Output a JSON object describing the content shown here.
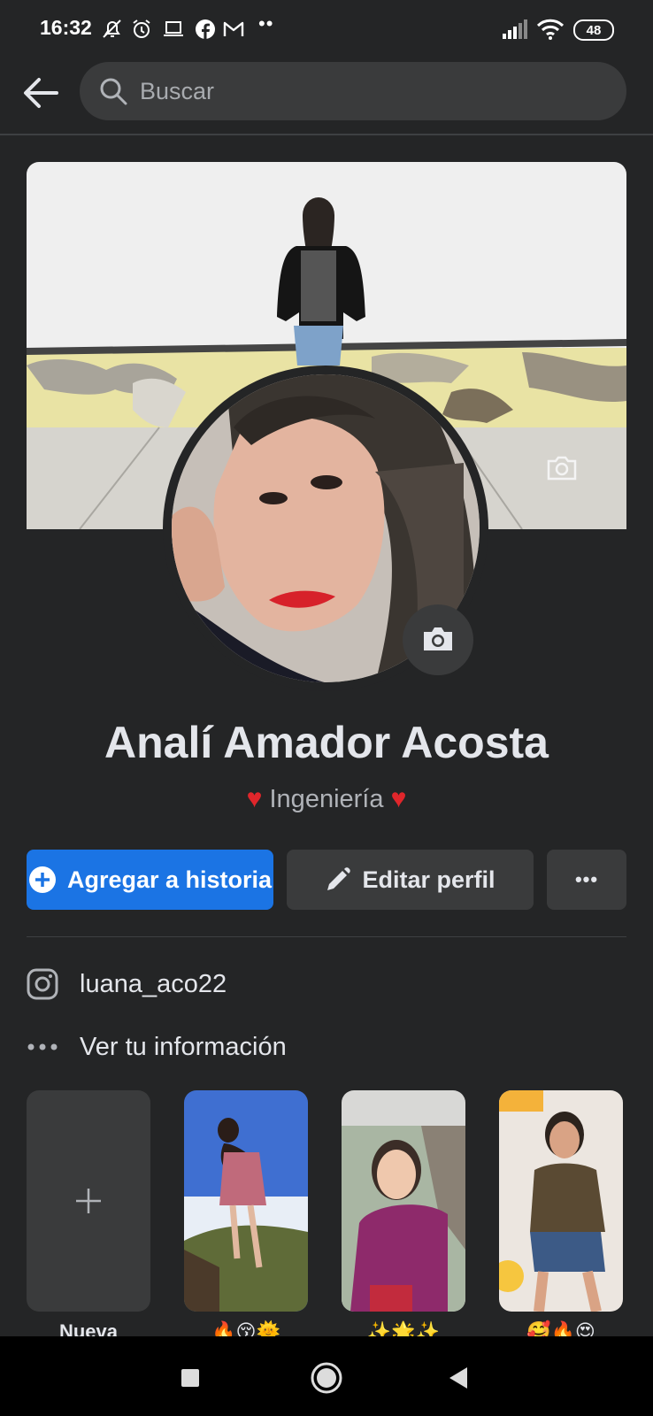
{
  "status_bar": {
    "time": "16:32",
    "icons": [
      "mute-icon",
      "alarm-icon",
      "laptop-icon",
      "facebook-icon",
      "gmail-icon"
    ],
    "more": "••",
    "battery": "48"
  },
  "header": {
    "search_placeholder": "Buscar"
  },
  "profile": {
    "name": "Analí Amador Acosta",
    "bio_heart_left": "♥",
    "bio_text": "Ingeniería",
    "bio_heart_right": "♥"
  },
  "actions": {
    "story_label": "Agregar a historia",
    "edit_label": "Editar perfil",
    "more_label": "•••"
  },
  "info": {
    "instagram": "luana_aco22",
    "see_info": "Ver tu información"
  },
  "highlights": [
    {
      "label": "Nueva"
    },
    {
      "label": "🔥😚🌞"
    },
    {
      "label": "✨🌟✨"
    },
    {
      "label": "🥰🔥😍"
    }
  ],
  "colors": {
    "background": "#242526",
    "primary_button": "#1b74e4",
    "secondary_button": "#3a3b3c",
    "heart": "#e0262b"
  }
}
